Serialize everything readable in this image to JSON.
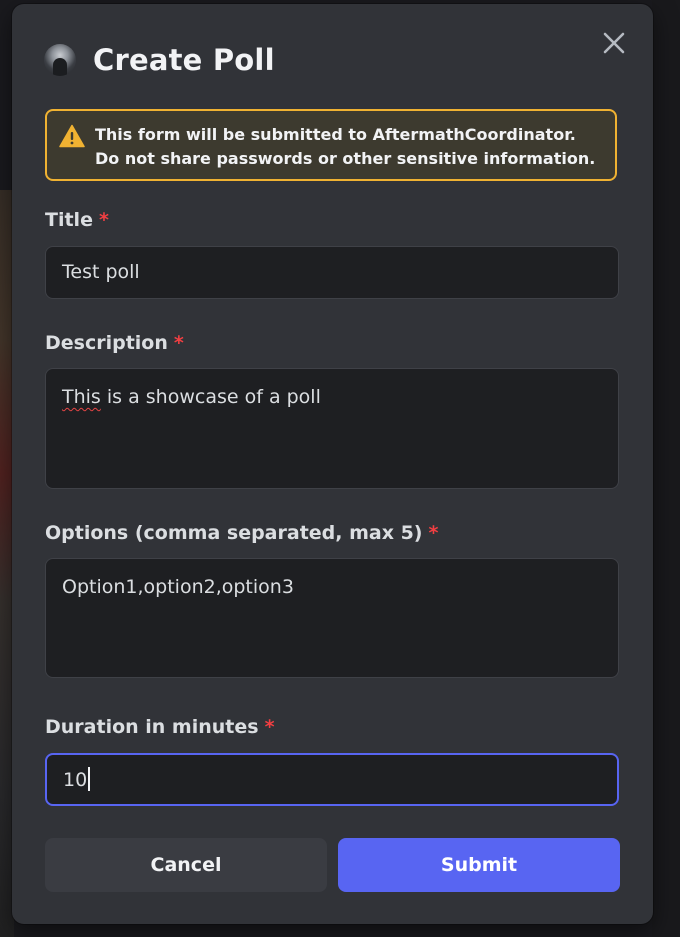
{
  "modal": {
    "title": "Create Poll",
    "close_icon": "close-icon",
    "avatar_icon": "avatar"
  },
  "warning": {
    "icon": "warning-icon",
    "text_prefix": "This form will be submitted to ",
    "target": "AftermathCoordinator",
    "text_suffix": ". Do not share passwords or other sensitive information.",
    "border_color": "#f0b232"
  },
  "fields": {
    "title": {
      "label": "Title",
      "required_mark": "*",
      "value": "Test poll"
    },
    "description": {
      "label": "Description",
      "required_mark": "*",
      "value_first_word": "This",
      "value_rest": " is a showcase of a poll"
    },
    "options": {
      "label": "Options (comma separated, max 5)",
      "required_mark": "*",
      "value": "Option1,option2,option3"
    },
    "duration": {
      "label": "Duration in minutes",
      "required_mark": "*",
      "value": "10",
      "focused": true
    }
  },
  "buttons": {
    "cancel_label": "Cancel",
    "submit_label": "Submit",
    "submit_color": "#5865f2"
  }
}
